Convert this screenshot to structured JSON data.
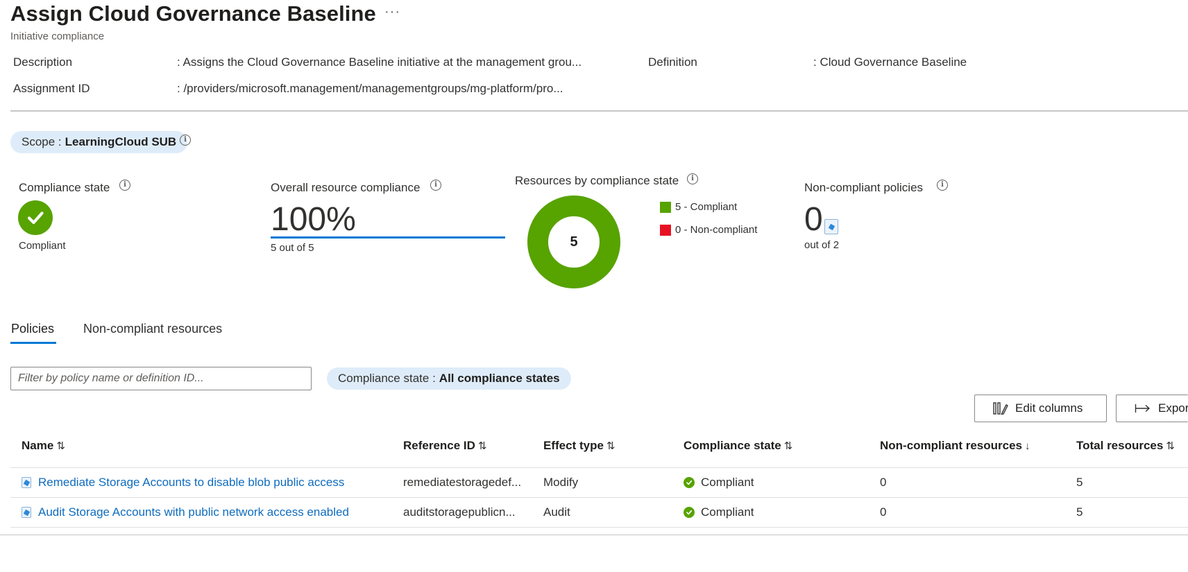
{
  "header": {
    "title": "Assign Cloud Governance Baseline",
    "more_label": "···",
    "subtitle": "Initiative compliance"
  },
  "essentials": {
    "description_label": "Description",
    "description_value": ": Assigns the Cloud Governance Baseline initiative at the management grou...",
    "assignment_id_label": "Assignment ID",
    "assignment_id_value": ": /providers/microsoft.management/managementgroups/mg-platform/pro...",
    "definition_label": "Definition",
    "definition_value": ": Cloud Governance Baseline"
  },
  "scope": {
    "label": "Scope :",
    "value": "LearningCloud SUB"
  },
  "cards": {
    "compliance_state": {
      "label": "Compliance state",
      "status": "Compliant",
      "color": "#57a300"
    },
    "overall_resource_compliance": {
      "label": "Overall resource compliance",
      "percent": "100%",
      "detail": "5 out of 5",
      "fraction": 1.0
    },
    "resources_by_state": {
      "label": "Resources by compliance state",
      "total": "5",
      "compliant_count": 5,
      "noncompliant_count": 0,
      "legend": [
        {
          "text": "5 - Compliant",
          "color": "#57a300"
        },
        {
          "text": "0 - Non-compliant",
          "color": "#e81123"
        }
      ]
    },
    "noncompliant_policies": {
      "label": "Non-compliant policies",
      "count": "0",
      "detail": "out of 2"
    }
  },
  "tabs": [
    {
      "label": "Policies",
      "active": true
    },
    {
      "label": "Non-compliant resources",
      "active": false
    }
  ],
  "filters": {
    "search_placeholder": "Filter by policy name or definition ID...",
    "compliance_label": "Compliance state :",
    "compliance_value": "All compliance states"
  },
  "toolbar": {
    "edit_columns": "Edit columns",
    "export": "Export"
  },
  "table": {
    "columns": [
      {
        "label": "Name",
        "sort": "⇅"
      },
      {
        "label": "Reference ID",
        "sort": "⇅"
      },
      {
        "label": "Effect type",
        "sort": "⇅"
      },
      {
        "label": "Compliance state",
        "sort": "⇅"
      },
      {
        "label": "Non-compliant resources",
        "sort": "↓"
      },
      {
        "label": "Total resources",
        "sort": "⇅"
      }
    ],
    "rows": [
      {
        "name": "Remediate Storage Accounts to disable blob public access",
        "reference_id": "remediatestoragedef...",
        "effect": "Modify",
        "state": "Compliant",
        "noncompliant": "0",
        "total": "5"
      },
      {
        "name": "Audit Storage Accounts with public network access enabled",
        "reference_id": "auditstoragepublicn...",
        "effect": "Audit",
        "state": "Compliant",
        "noncompliant": "0",
        "total": "5"
      }
    ]
  }
}
